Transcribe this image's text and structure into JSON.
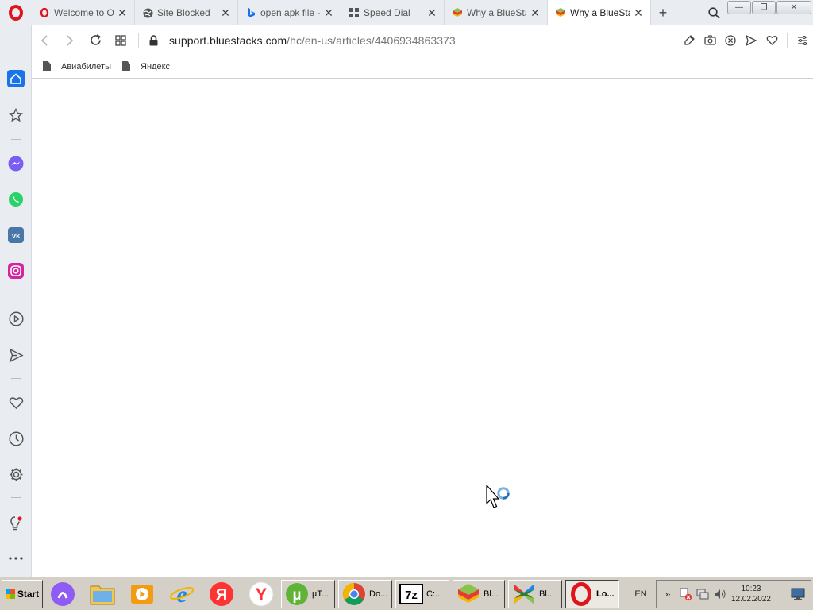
{
  "tabs": [
    {
      "label": "Welcome to Op",
      "icon": "opera-icon",
      "active": false
    },
    {
      "label": "Site Blocked",
      "icon": "globe-icon",
      "active": false
    },
    {
      "label": "open apk file -",
      "icon": "bing-icon",
      "active": false
    },
    {
      "label": "Speed Dial",
      "icon": "speed-dial-icon",
      "active": false
    },
    {
      "label": "Why a BlueStac",
      "icon": "bluestacks-icon",
      "active": false
    },
    {
      "label": "Why a BlueStac",
      "icon": "bluestacks-icon",
      "active": true
    }
  ],
  "tab_close_glyph": "✕",
  "new_tab_glyph": "+",
  "window_controls": {
    "minimize": "—",
    "restore": "❐",
    "close": "✕"
  },
  "address": {
    "host": "support.bluestacks.com",
    "path": "/hc/en-us/articles/4406934863373"
  },
  "bookmarks": [
    {
      "label": "Авиабилеты"
    },
    {
      "label": "Яндекс"
    }
  ],
  "sidebar_items": [
    "home-icon",
    "bookmarks-icon",
    "messenger-icon",
    "whatsapp-icon",
    "vk-icon",
    "instagram-icon",
    "player-icon",
    "send-icon",
    "heart-icon",
    "history-icon",
    "settings-icon",
    "tips-icon",
    "more-icon"
  ],
  "taskbar": {
    "start_label": "Start",
    "tasks": [
      {
        "label": "µT...",
        "icon": "utorrent-icon"
      },
      {
        "label": "Do...",
        "icon": "chrome-icon"
      },
      {
        "label": "C:...",
        "icon": "7zip-icon"
      },
      {
        "label": "Bl...",
        "icon": "bluestacks-icon"
      },
      {
        "label": "Bl...",
        "icon": "bluestacks-x-icon"
      },
      {
        "label": "Lo...",
        "icon": "opera-icon",
        "active": true
      }
    ],
    "language": "EN",
    "tray_expand": "»",
    "time": "10:23",
    "date": "12.02.2022"
  },
  "colors": {
    "opera_red": "#e0141c",
    "sidebar_accent": "#1a73e8",
    "bluestacks_green": "#8bc34a"
  }
}
